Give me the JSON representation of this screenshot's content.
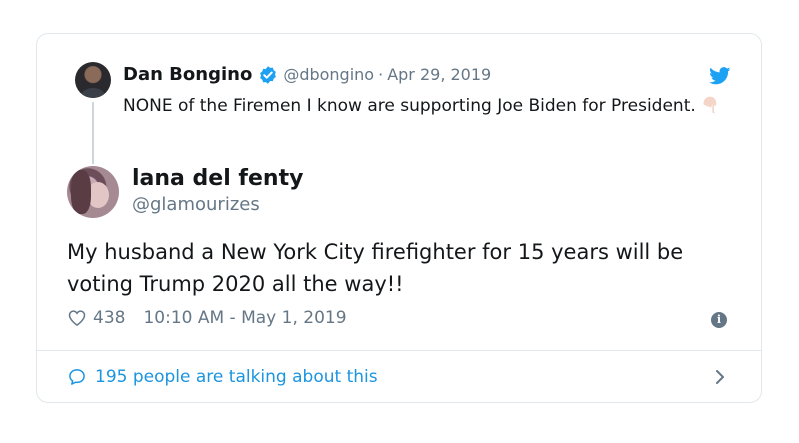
{
  "quoted_tweet": {
    "author_name": "Dan Bongino",
    "verified_icon": "verified-badge-icon",
    "handle": "@dbongino",
    "separator": "·",
    "date": "Apr 29, 2019",
    "text": "NONE of the Firemen I know are supporting Joe Biden for President.",
    "emoji": "backhand-index-pointing-down"
  },
  "tweet": {
    "author_name": "lana del fenty",
    "handle": "@glamourizes",
    "text": "My husband a New York City firefighter for 15 years will be voting Trump 2020 all the way!!",
    "like_count": "438",
    "timestamp": "10:10 AM - May 1, 2019",
    "info_icon": "i"
  },
  "footer": {
    "talking_text": "195 people are talking about this"
  },
  "colors": {
    "accent": "#1da1f2",
    "link": "#1b95e0",
    "muted": "#657786",
    "border": "#e1e8ed"
  }
}
